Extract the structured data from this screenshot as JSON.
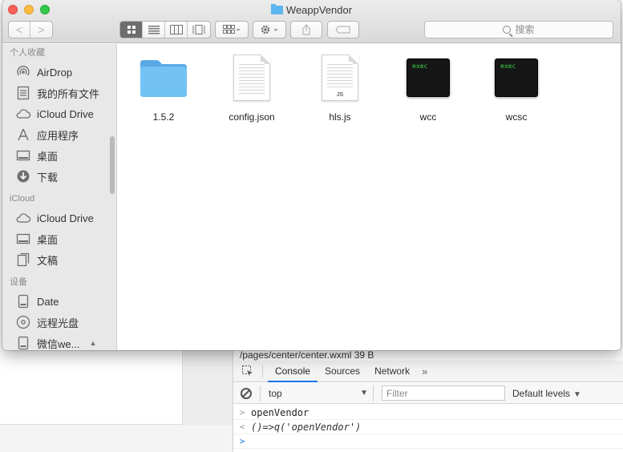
{
  "window": {
    "title": "WeappVendor"
  },
  "toolbar": {
    "nav_back": "<",
    "nav_forward": ">",
    "search_placeholder": "搜索"
  },
  "sidebar": {
    "sections": [
      {
        "header": "个人收藏",
        "items": [
          {
            "label": "AirDrop",
            "icon": "airdrop-icon"
          },
          {
            "label": "我的所有文件",
            "icon": "all-files-icon"
          },
          {
            "label": "iCloud Drive",
            "icon": "cloud-icon"
          },
          {
            "label": "应用程序",
            "icon": "applications-icon"
          },
          {
            "label": "桌面",
            "icon": "desktop-icon"
          },
          {
            "label": "下载",
            "icon": "download-icon"
          }
        ]
      },
      {
        "header": "iCloud",
        "items": [
          {
            "label": "iCloud Drive",
            "icon": "cloud-icon"
          },
          {
            "label": "桌面",
            "icon": "desktop-icon"
          },
          {
            "label": "文稿",
            "icon": "documents-icon"
          }
        ]
      },
      {
        "header": "设备",
        "items": [
          {
            "label": "Date",
            "icon": "disk-icon"
          },
          {
            "label": "远程光盘",
            "icon": "optical-disc-icon"
          },
          {
            "label": "微信we...",
            "icon": "disk-icon"
          }
        ]
      }
    ]
  },
  "files": [
    {
      "name": "1.5.2",
      "type": "folder"
    },
    {
      "name": "config.json",
      "type": "document"
    },
    {
      "name": "hls.js",
      "type": "js-document",
      "tag": "JS"
    },
    {
      "name": "wcc",
      "type": "exec",
      "tag": "exec"
    },
    {
      "name": "wcsc",
      "type": "exec",
      "tag": "exec"
    }
  ],
  "devtools": {
    "file_row": "/pages/center/center.wxml      39 B",
    "tabs": [
      "Console",
      "Sources",
      "Network"
    ],
    "active_tab": "Console",
    "more_tabs": "»",
    "context": "top",
    "filter_placeholder": "Filter",
    "levels": "Default levels",
    "console_lines": [
      {
        "kind": "input",
        "gutter": ">",
        "text": "openVendor"
      },
      {
        "kind": "result",
        "gutter": "<",
        "text": "()=>q('openVendor')"
      },
      {
        "kind": "prompt",
        "gutter": ">",
        "text": ""
      }
    ]
  },
  "colors": {
    "folder_blue": "#5bb5ef",
    "close_red": "#fc605b",
    "minimize_yellow": "#fdbc40",
    "maximize_green": "#34c84a",
    "devtools_accent": "#1a73e8",
    "exec_text_green": "#3bd24b"
  }
}
